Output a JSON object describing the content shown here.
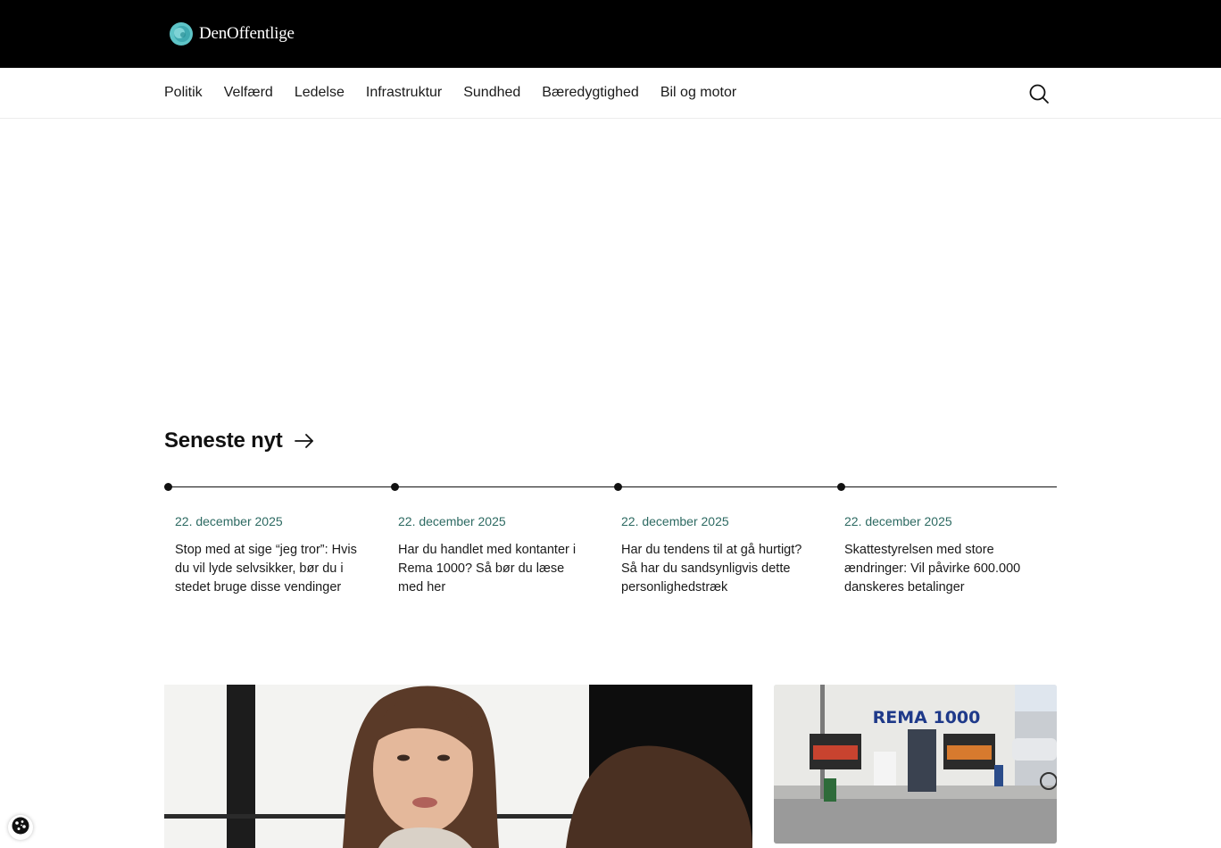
{
  "brand": {
    "name": "DenOffentlige"
  },
  "nav": {
    "items": [
      "Politik",
      "Velfærd",
      "Ledelse",
      "Infrastruktur",
      "Sundhed",
      "Bæredygtighed",
      "Bil og motor"
    ]
  },
  "latest": {
    "heading": "Seneste nyt",
    "items": [
      {
        "date": "22. december 2025",
        "title": "Stop med at sige “jeg tror”: Hvis du vil lyde selvsikker, bør du i stedet bruge disse vendinger"
      },
      {
        "date": "22. december 2025",
        "title": "Har du handlet med kontanter i Rema 1000? Så bør du læse med her"
      },
      {
        "date": "22. december 2025",
        "title": "Har du tendens til at gå hurtigt? Så har du sandsynligvis dette personlighedstræk"
      },
      {
        "date": "22. december 2025",
        "title": "Skattestyrelsen med store ændringer: Vil påvirke 600.000 danskeres betalinger"
      }
    ]
  },
  "store_sign": {
    "text": "REMA 1000"
  },
  "icons": {
    "logo": "logo-mark-icon",
    "search": "search-icon",
    "arrow": "arrow-right-icon",
    "cookie": "cookie-icon"
  },
  "colors": {
    "header_bg": "#000000",
    "date_text": "#2d6a62",
    "logo_teal": "#5ec4c7"
  }
}
